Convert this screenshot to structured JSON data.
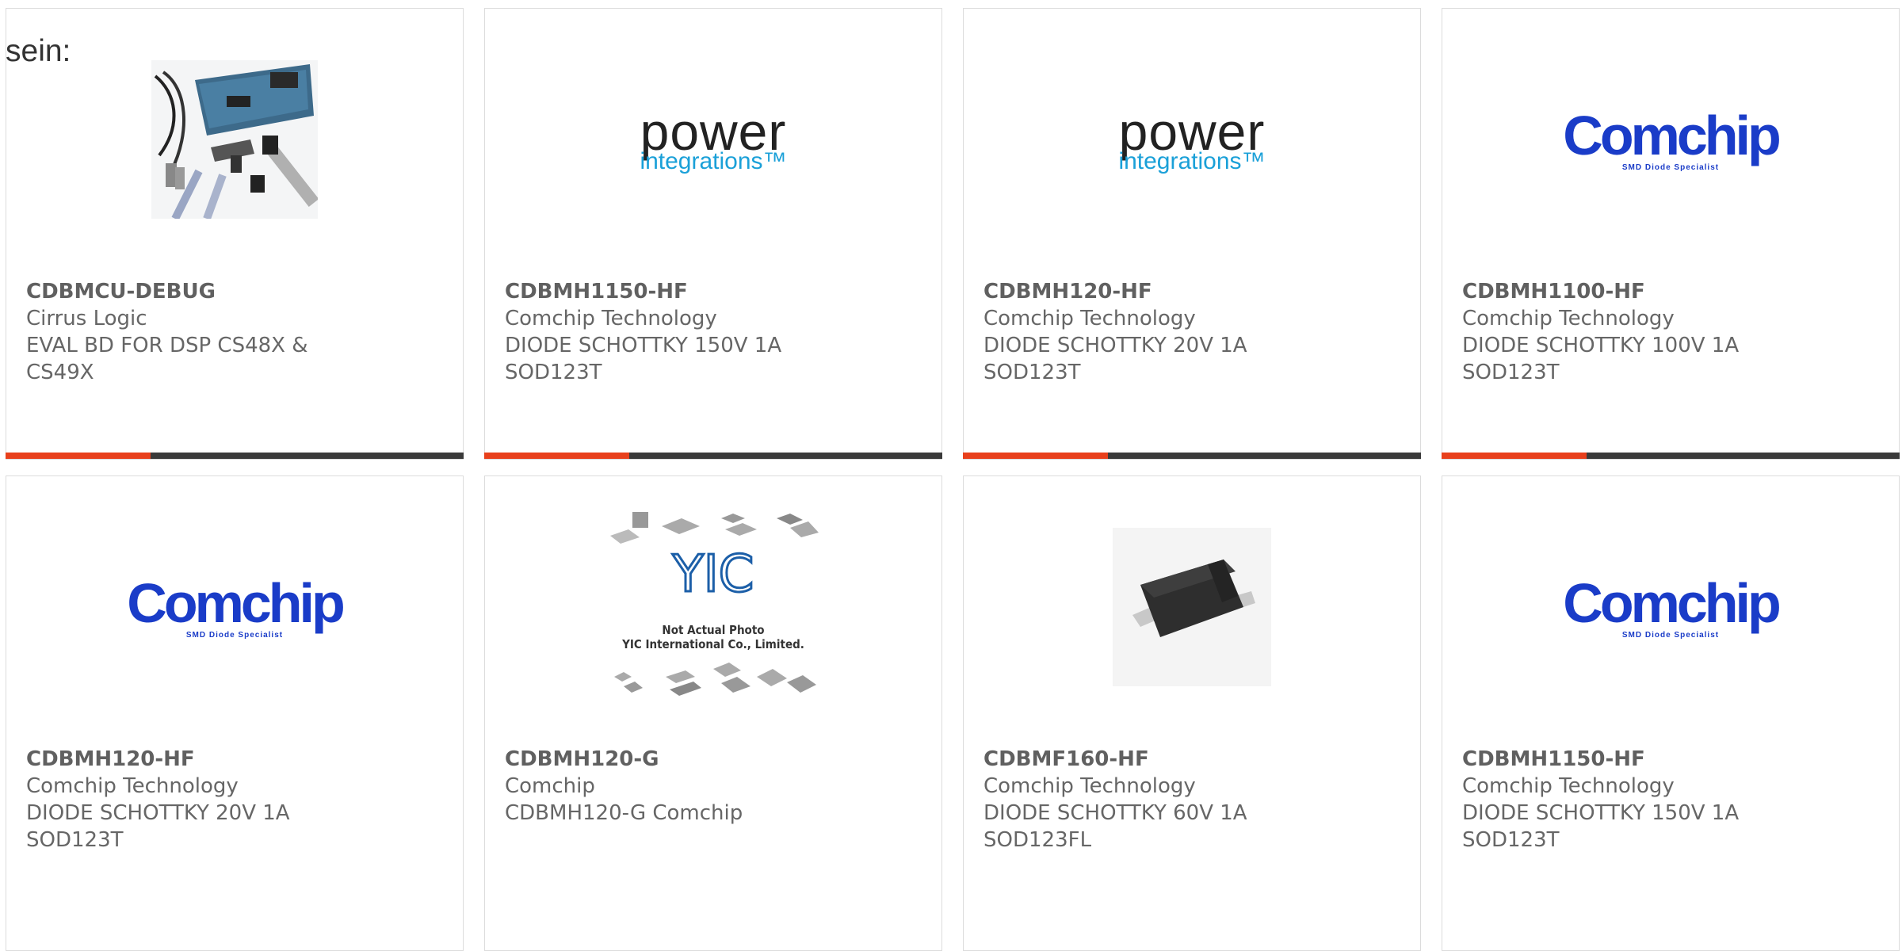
{
  "intro_text": "sein:",
  "accent_color": "#e8401c",
  "bar_color": "#3a3a3a",
  "products": [
    {
      "part": "CDBMCU-DEBUG",
      "manufacturer": "Cirrus Logic",
      "desc1": "EVAL BD FOR DSP CS48X &",
      "desc2": "CS49X",
      "image": "dev-board-photo"
    },
    {
      "part": "CDBMH1150-HF",
      "manufacturer": "Comchip Technology",
      "desc1": "DIODE SCHOTTKY 150V 1A",
      "desc2": "SOD123T",
      "image": "power-integrations-logo"
    },
    {
      "part": "CDBMH120-HF",
      "manufacturer": "Comchip Technology",
      "desc1": "DIODE SCHOTTKY 20V 1A",
      "desc2": "SOD123T",
      "image": "power-integrations-logo"
    },
    {
      "part": "CDBMH1100-HF",
      "manufacturer": "Comchip Technology",
      "desc1": "DIODE SCHOTTKY 100V 1A",
      "desc2": "SOD123T",
      "image": "comchip-logo"
    },
    {
      "part": "CDBMH120-HF",
      "manufacturer": "Comchip Technology",
      "desc1": "DIODE SCHOTTKY 20V 1A",
      "desc2": "SOD123T",
      "image": "comchip-logo"
    },
    {
      "part": "CDBMH120-G",
      "manufacturer": "Comchip",
      "desc1": "CDBMH120-G Comchip",
      "desc2": "",
      "image": "yic-not-actual-photo"
    },
    {
      "part": "CDBMF160-HF",
      "manufacturer": "Comchip Technology",
      "desc1": "DIODE SCHOTTKY 60V 1A",
      "desc2": "SOD123FL",
      "image": "sod123fl-package-photo"
    },
    {
      "part": "CDBMH1150-HF",
      "manufacturer": "Comchip Technology",
      "desc1": "DIODE SCHOTTKY 150V 1A",
      "desc2": "SOD123T",
      "image": "comchip-logo"
    }
  ],
  "logos": {
    "power_word": "power",
    "power_sub": "integrations™",
    "comchip_word": "Comchip",
    "comchip_tag": "SMD Diode Specialist",
    "yic_mark": "YIC",
    "yic_line1": "Not Actual Photo",
    "yic_line2": "YIC International Co., Limited."
  }
}
